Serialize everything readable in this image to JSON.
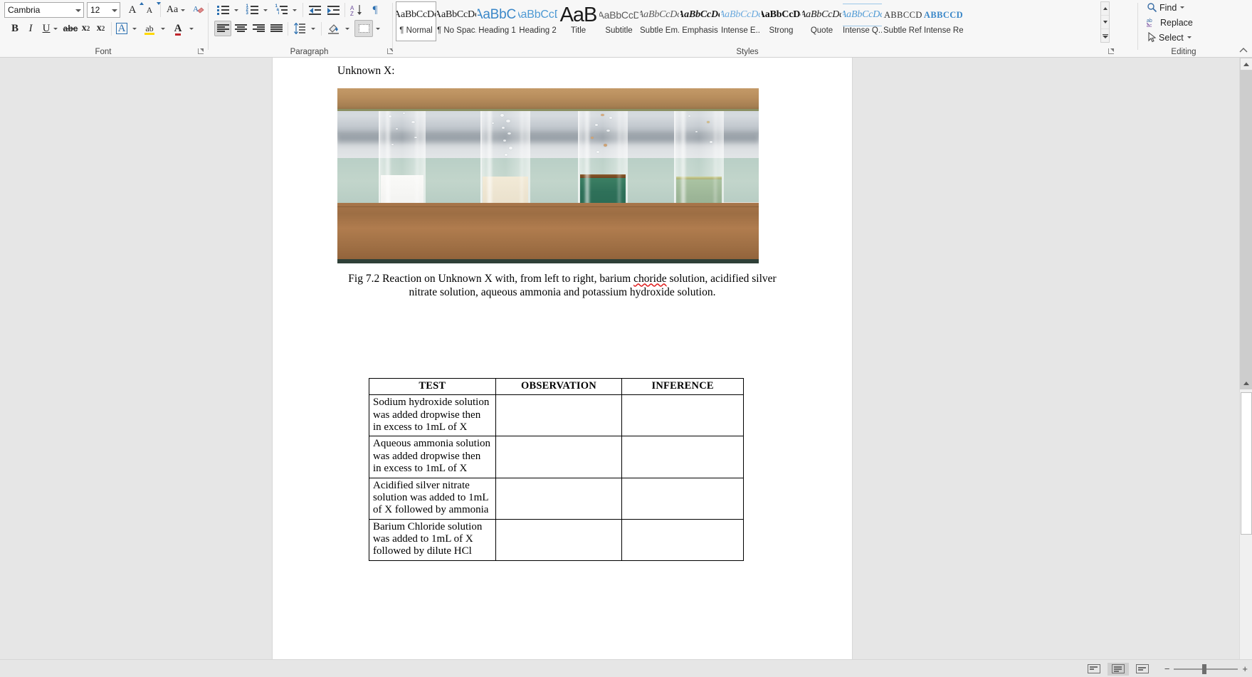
{
  "ribbon": {
    "font_group": {
      "label": "Font",
      "font_name": "Cambria",
      "font_size": "12",
      "grow_font": "A",
      "shrink_font": "A",
      "change_case": "Aa",
      "clear_formatting": "clear-formatting-icon",
      "bold": "B",
      "italic": "I",
      "underline": "U",
      "strikethrough": "abc",
      "subscript": "x",
      "subscript_n": "2",
      "superscript": "x",
      "superscript_n": "2",
      "text_effects": "A",
      "highlight": "ab",
      "font_color": "A"
    },
    "paragraph_group": {
      "label": "Paragraph",
      "bullets": "bullets-icon",
      "numbering": "numbering-icon",
      "multilevel": "multilevel-list-icon",
      "decrease_indent": "decrease-indent-icon",
      "increase_indent": "increase-indent-icon",
      "sort": "sort-icon",
      "show_marks": "¶",
      "align_left": "align-left-icon",
      "align_center": "align-center-icon",
      "align_right": "align-right-icon",
      "justify": "justify-icon",
      "line_spacing": "line-spacing-icon",
      "shading": "shading-icon",
      "borders": "borders-icon"
    },
    "styles_group": {
      "label": "Styles",
      "items": [
        {
          "preview": "AaBbCcDc",
          "name": "¶ Normal",
          "kind": "normal",
          "selected": true
        },
        {
          "preview": "AaBbCcDc",
          "name": "¶ No Spac...",
          "kind": "normal",
          "selected": false
        },
        {
          "preview": "AaBbC(",
          "name": "Heading 1",
          "kind": "h1",
          "selected": false
        },
        {
          "preview": "AaBbCcD",
          "name": "Heading 2",
          "kind": "h2",
          "selected": false
        },
        {
          "preview": "AaB",
          "name": "Title",
          "kind": "title",
          "selected": false
        },
        {
          "preview": "AaBbCcD",
          "name": "Subtitle",
          "kind": "subtitle",
          "selected": false
        },
        {
          "preview": "AaBbCcDc",
          "name": "Subtle Em...",
          "kind": "subtleem",
          "selected": false
        },
        {
          "preview": "AaBbCcDc",
          "name": "Emphasis",
          "kind": "emphasis",
          "selected": false
        },
        {
          "preview": "AaBbCcDc",
          "name": "Intense E...",
          "kind": "intenseem",
          "selected": false
        },
        {
          "preview": "AaBbCcDc",
          "name": "Strong",
          "kind": "strong",
          "selected": false
        },
        {
          "preview": "AaBbCcDc",
          "name": "Quote",
          "kind": "quote",
          "selected": false
        },
        {
          "preview": "AaBbCcDc",
          "name": "Intense Q...",
          "kind": "intenseq",
          "selected": false
        },
        {
          "preview": "AABBCCDC",
          "name": "Subtle Ref...",
          "kind": "subtleref",
          "selected": false
        },
        {
          "preview": "AABBCCDC",
          "name": "Intense Re...",
          "kind": "intenseref",
          "selected": false
        }
      ]
    },
    "editing_group": {
      "label": "Editing",
      "find": "Find",
      "replace": "Replace",
      "select": "Select"
    }
  },
  "document": {
    "heading": "Unknown X:",
    "figure": {
      "alt": "Four test tubes in a wooden rack showing precipitates from reactions with Unknown X",
      "tubes": [
        {
          "name": "barium-chloride-tube",
          "liquid_color": "#f3f3f1",
          "label": "white precipitate"
        },
        {
          "name": "acidified-silver-nitrate-tube",
          "liquid_color": "#ece3cf",
          "label": "cream precipitate"
        },
        {
          "name": "aqueous-ammonia-tube",
          "liquid_color": "#2e7059",
          "label": "dark green precipitate"
        },
        {
          "name": "potassium-hydroxide-tube",
          "liquid_color": "#9cb597",
          "label": "pale green precipitate"
        }
      ]
    },
    "caption": {
      "part1": "Fig 7.2 Reaction on Unknown X with, from left to right, barium ",
      "misspelled": "choride",
      "part2": " solution, acidified silver nitrate solution, aqueous ammonia and potassium hydroxide solution."
    },
    "table": {
      "headers": [
        "TEST",
        "OBSERVATION",
        "INFERENCE"
      ],
      "rows": [
        {
          "test": "Sodium hydroxide solution was added dropwise then in excess to 1mL of X",
          "observation": "",
          "inference": ""
        },
        {
          "test": "Aqueous ammonia solution was added dropwise then in excess to 1mL of X",
          "observation": "",
          "inference": ""
        },
        {
          "test": "Acidified silver nitrate solution was added to 1mL of X followed by ammonia",
          "observation": "",
          "inference": ""
        },
        {
          "test": "Barium Chloride solution was added to 1mL of X followed by dilute HCl",
          "observation": "",
          "inference": ""
        }
      ]
    }
  },
  "scrollbar": {
    "up_arrow": "scroll-up-icon",
    "down_arrow": "scroll-down-icon"
  },
  "statusbar": {
    "view_read": "read-mode-icon",
    "view_print": "print-layout-icon",
    "view_web": "web-layout-icon",
    "zoom_out": "−",
    "zoom_in": "+"
  },
  "colors": {
    "accent_blue": "#2b6fb0",
    "ribbon_bg": "#f7f7f7",
    "doc_bg": "#e6e6e6",
    "page_bg": "#ffffff",
    "spellcheck_red": "#e02020"
  }
}
